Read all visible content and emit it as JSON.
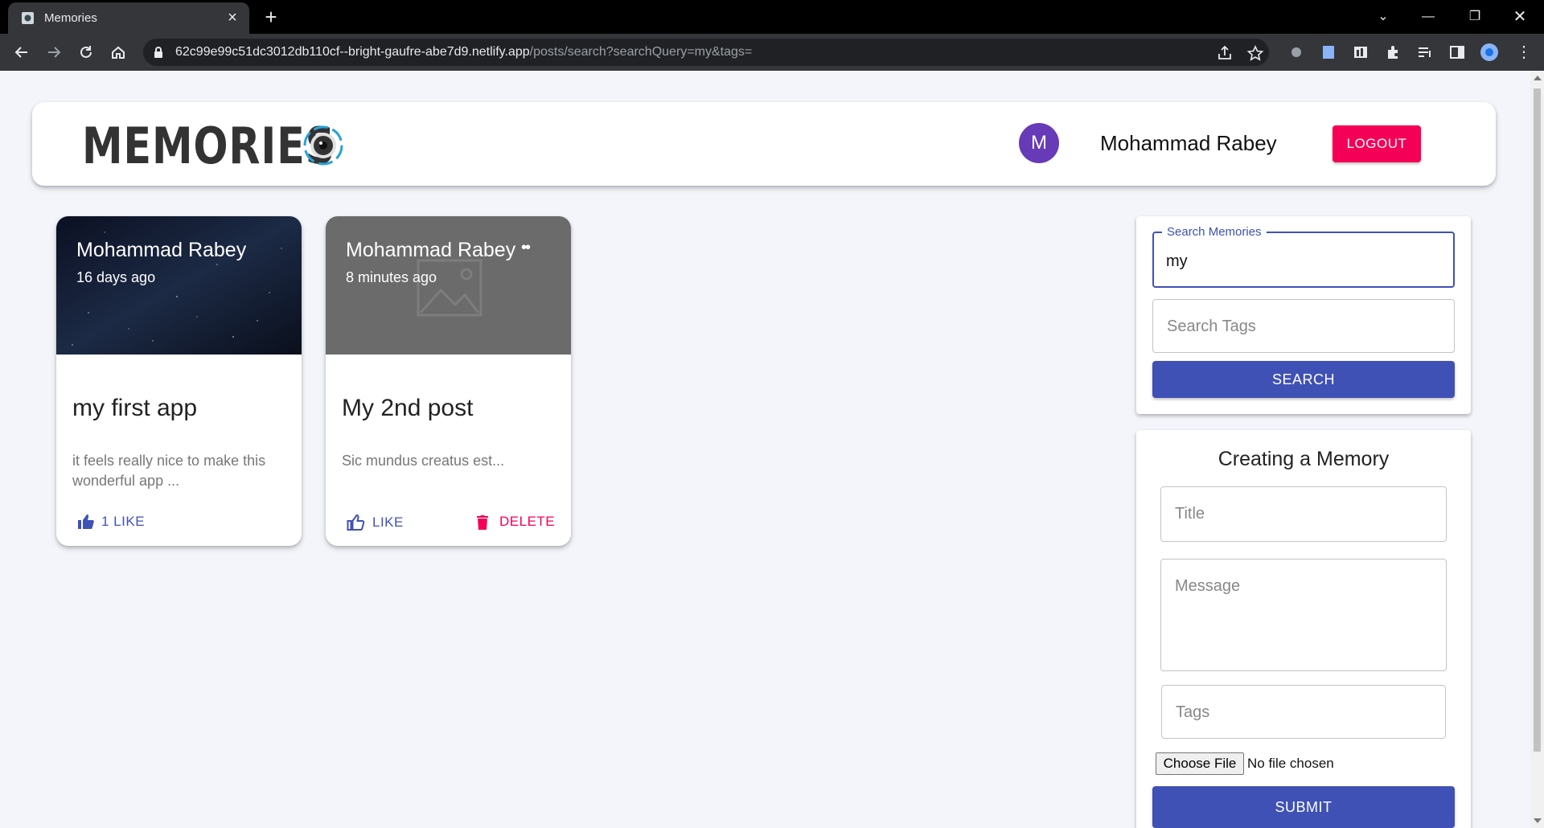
{
  "browser": {
    "tab_title": "Memories",
    "url_host": "62c99e99c51dc3012db110cf--bright-gaufre-abe7d9.netlify.app",
    "url_path": "/posts/search?searchQuery=my&tags="
  },
  "header": {
    "logo_text": "MEMORIES",
    "avatar_letter": "M",
    "user_name": "Mohammad Rabey",
    "logout_label": "LOGOUT"
  },
  "posts": [
    {
      "author": "Mohammad Rabey",
      "time": "16 days ago",
      "title": "my first app",
      "message": "it feels really nice to make this wonderful app ...",
      "like_label": "1 LIKE"
    },
    {
      "author": "Mohammad Rabey",
      "time": "8 minutes ago",
      "title": "My 2nd post",
      "message": "Sic mundus creatus est...",
      "like_label": "LIKE",
      "delete_label": "DELETE"
    }
  ],
  "search": {
    "memories_label": "Search Memories",
    "memories_value": "my",
    "tags_placeholder": "Search Tags",
    "button_label": "SEARCH"
  },
  "form": {
    "title": "Creating a Memory",
    "title_placeholder": "Title",
    "message_placeholder": "Message",
    "tags_placeholder": "Tags",
    "choose_file_label": "Choose File",
    "no_file_text": "No file chosen",
    "submit_label": "SUBMIT"
  },
  "colors": {
    "primary": "#3f51b5",
    "secondary": "#f50057",
    "avatar": "#673ab7"
  }
}
